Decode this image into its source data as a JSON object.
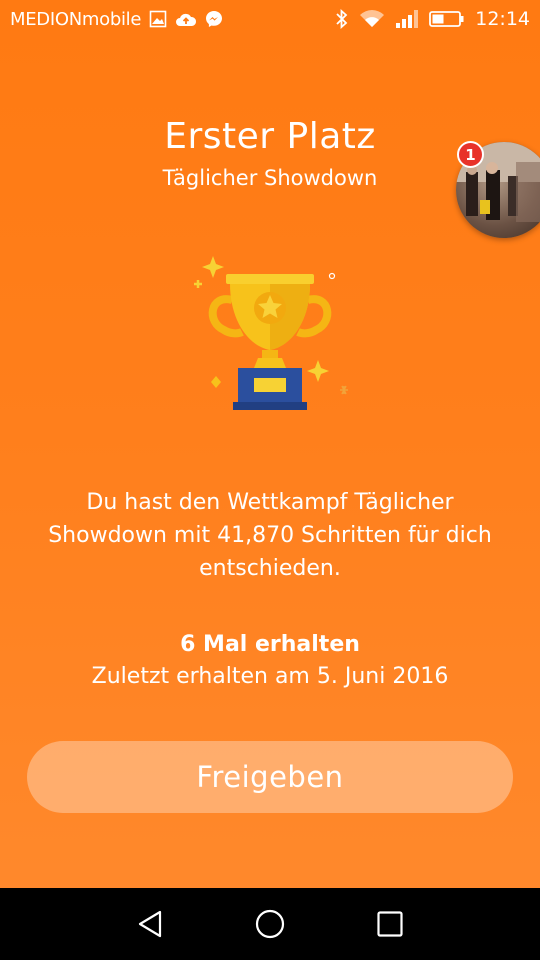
{
  "status_bar": {
    "carrier": "MEDIONmobile",
    "time": "12:14",
    "icons": [
      "image-icon",
      "cloud-upload-icon",
      "messenger-icon",
      "bluetooth-icon",
      "wifi-icon",
      "signal-icon",
      "battery-icon"
    ]
  },
  "award": {
    "title": "Erster Platz",
    "subtitle": "Täglicher Showdown",
    "message": "Du hast den Wettkampf Täglicher Showdown mit 41,870 Schritten für dich entschieden.",
    "count": "6 Mal erhalten",
    "last_received": "Zuletzt erhalten am 5. Juni 2016"
  },
  "chat_head": {
    "badge": "1"
  },
  "share_button": {
    "label": "Freigeben"
  },
  "colors": {
    "background": "#ff7a12",
    "trophy_gold": "#f7c21b",
    "trophy_base": "#2b4f9e",
    "badge_red": "#e8322a"
  }
}
